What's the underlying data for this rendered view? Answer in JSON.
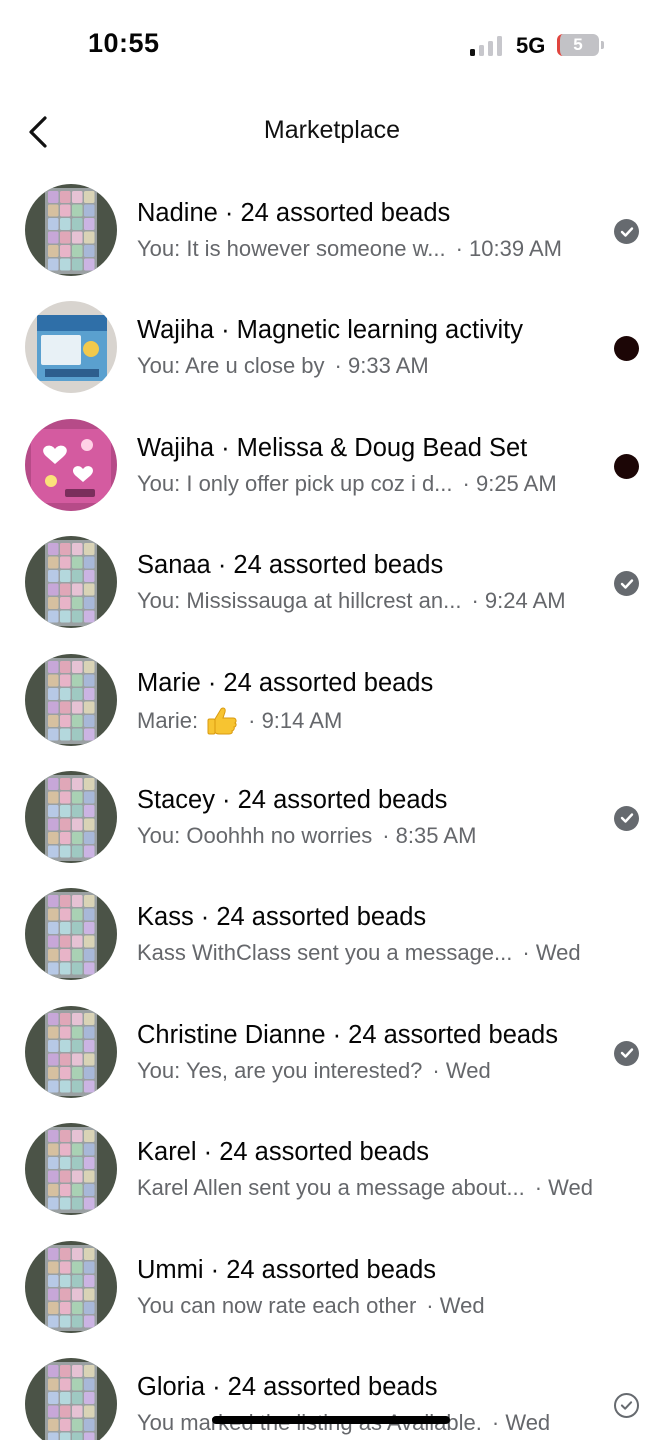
{
  "status_bar": {
    "time": "10:55",
    "network": "5G",
    "battery": "5",
    "signal_bars_active": 1,
    "signal_bars_total": 4
  },
  "nav": {
    "back_icon": "chevron-left-icon",
    "title": "Marketplace"
  },
  "colors": {
    "title_text": "#050505",
    "secondary_text": "#65676b",
    "read_indicator": "#666a6f",
    "unread_dot": "#1c0606"
  },
  "conversations": [
    {
      "title": "Nadine · 24 assorted beads",
      "message": "You: It is however someone w...",
      "time": "· 10:39 AM",
      "indicator": "read-check",
      "thumbnail": "beads-organizer"
    },
    {
      "title": "Wajiha · Magnetic learning activity",
      "message": "You: Are u close by",
      "time": "· 9:33 AM",
      "indicator": "unread-dot",
      "thumbnail": "sea-creatures-box"
    },
    {
      "title": "Wajiha · Melissa & Doug Bead Set",
      "message": "You: I only offer pick up coz i d...",
      "time": "· 9:25 AM",
      "indicator": "unread-dot",
      "thumbnail": "bead-set-box"
    },
    {
      "title": "Sanaa · 24 assorted beads",
      "message": "You: Mississauga at hillcrest an...",
      "time": "· 9:24 AM",
      "indicator": "read-check",
      "thumbnail": "beads-organizer"
    },
    {
      "title": "Marie · 24 assorted beads",
      "message": "Marie:",
      "emoji": "thumbs-up-icon",
      "time": "· 9:14 AM",
      "indicator": "none",
      "thumbnail": "beads-organizer"
    },
    {
      "title": "Stacey · 24 assorted beads",
      "message": "You: Ooohhh no worries",
      "time": "· 8:35 AM",
      "indicator": "read-check",
      "thumbnail": "beads-organizer"
    },
    {
      "title": "Kass · 24 assorted beads",
      "message": "Kass WithClass sent you a message...",
      "time": "· Wed",
      "indicator": "none",
      "thumbnail": "beads-organizer"
    },
    {
      "title": "Christine Dianne · 24 assorted beads",
      "message": "You: Yes, are you interested?",
      "time": "· Wed",
      "indicator": "read-check",
      "thumbnail": "beads-organizer"
    },
    {
      "title": "Karel · 24 assorted beads",
      "message": "Karel Allen sent you a message about...",
      "time": "· Wed",
      "indicator": "none",
      "thumbnail": "beads-organizer"
    },
    {
      "title": "Ummi · 24 assorted beads",
      "message": "You can now rate each other",
      "time": "· Wed",
      "indicator": "none",
      "thumbnail": "beads-organizer"
    },
    {
      "title": "Gloria · 24 assorted beads",
      "message": "You marked the listing as Available.",
      "time": "· Wed",
      "indicator": "sent-check",
      "thumbnail": "beads-organizer"
    }
  ]
}
